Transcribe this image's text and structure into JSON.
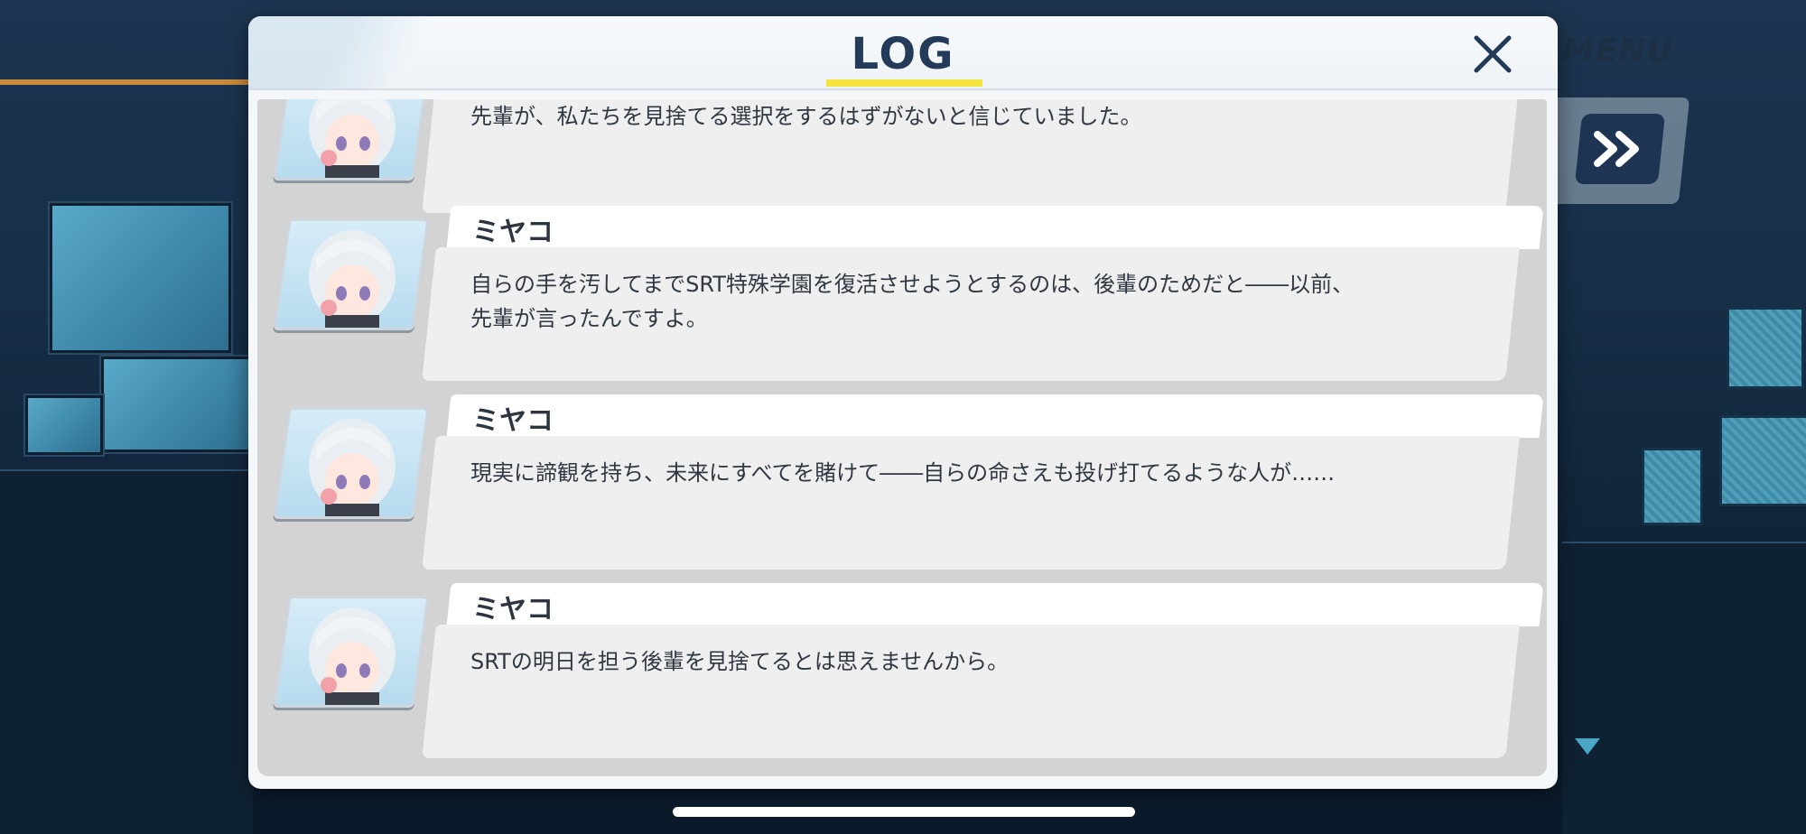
{
  "overlay": {
    "menu_label": "MENU"
  },
  "log_dialog": {
    "title": "LOG",
    "close_icon": "close-icon",
    "entries": [
      {
        "speaker": "",
        "text_lines": [
          "先輩が、私たちを見捨てる選択をするはずがないと信じていました。"
        ]
      },
      {
        "speaker": "ミヤコ",
        "text_lines": [
          "自らの手を汚してまでSRT特殊学園を復活させようとするのは、後輩のためだと――以前、",
          "先輩が言ったんですよ。"
        ]
      },
      {
        "speaker": "ミヤコ",
        "text_lines": [
          "現実に諦観を持ち、未来にすべてを賭けて――自らの命さえも投げ打てるような人が……"
        ]
      },
      {
        "speaker": "ミヤコ",
        "text_lines": [
          "SRTの明日を担う後輩を見捨てるとは思えませんから。"
        ]
      }
    ]
  },
  "colors": {
    "title": "#233a58",
    "underline_accent": "#f3e33a",
    "fast_forward_button": "#1d3552"
  }
}
